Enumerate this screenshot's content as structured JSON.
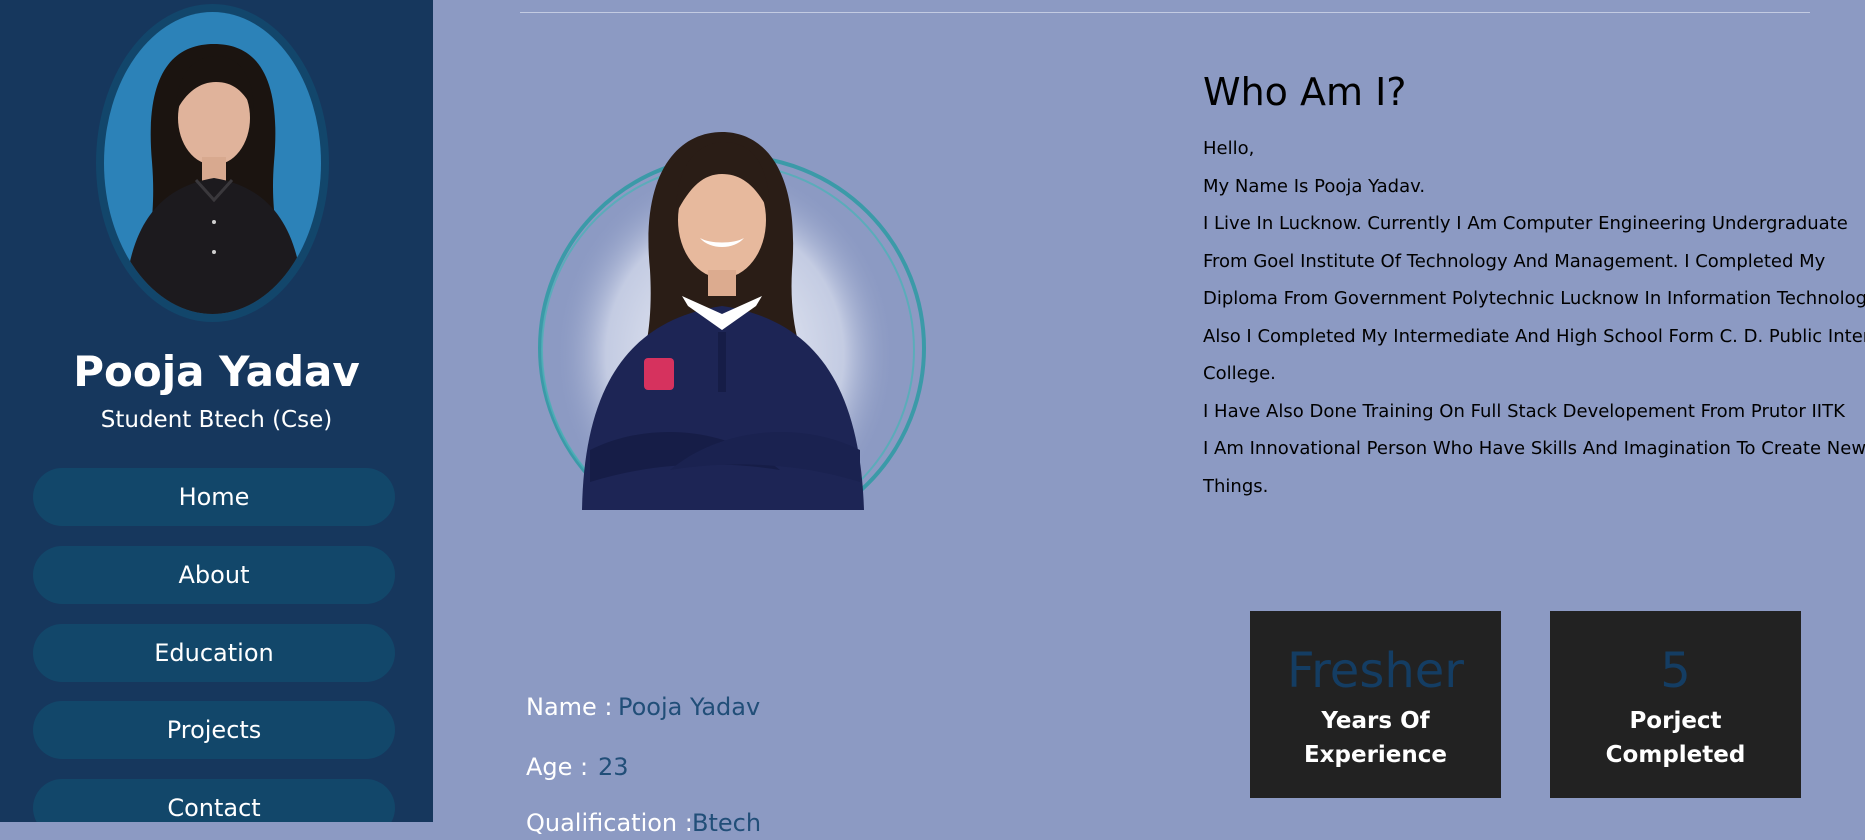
{
  "sidebar": {
    "profile_name": "Pooja Yadav",
    "profile_role": "Student Btech (Cse)",
    "nav": [
      {
        "label": "Home"
      },
      {
        "label": "About"
      },
      {
        "label": "Education"
      },
      {
        "label": "Projects"
      },
      {
        "label": "Contact"
      }
    ]
  },
  "about": {
    "heading": "Who Am I?",
    "paragraphs": [
      "Hello,",
      "My Name Is Pooja Yadav.",
      "I Live In Lucknow. Currently I Am Computer Engineering Undergraduate",
      "From Goel Institute Of Technology And Management. I Completed My",
      "Diploma From Government Polytechnic Lucknow In Information Technology.",
      "Also I Completed My Intermediate And High School Form C. D. Public Inter",
      "College.",
      "I Have Also Done Training On Full Stack Developement From Prutor IITK",
      "I Am Innovational Person Who Have Skills And Imagination To Create New",
      "Things."
    ]
  },
  "info": {
    "name_label": "Name :",
    "name_value": "Pooja Yadav",
    "age_label": "Age :",
    "age_value": "23",
    "qualification_label": "Qualification :",
    "qualification_value": "Btech"
  },
  "stats": [
    {
      "number": "Fresher",
      "label_line1": "Years Of",
      "label_line2": "Experience"
    },
    {
      "number": "5",
      "label_line1": "Porject",
      "label_line2": "Completed"
    }
  ],
  "colors": {
    "page_background": "#8c9ac3",
    "sidebar_background": "#16375d",
    "nav_button": "#12476a",
    "accent_ring": "#3b9aa8",
    "card_background": "#222222",
    "stat_number": "#143d63"
  }
}
